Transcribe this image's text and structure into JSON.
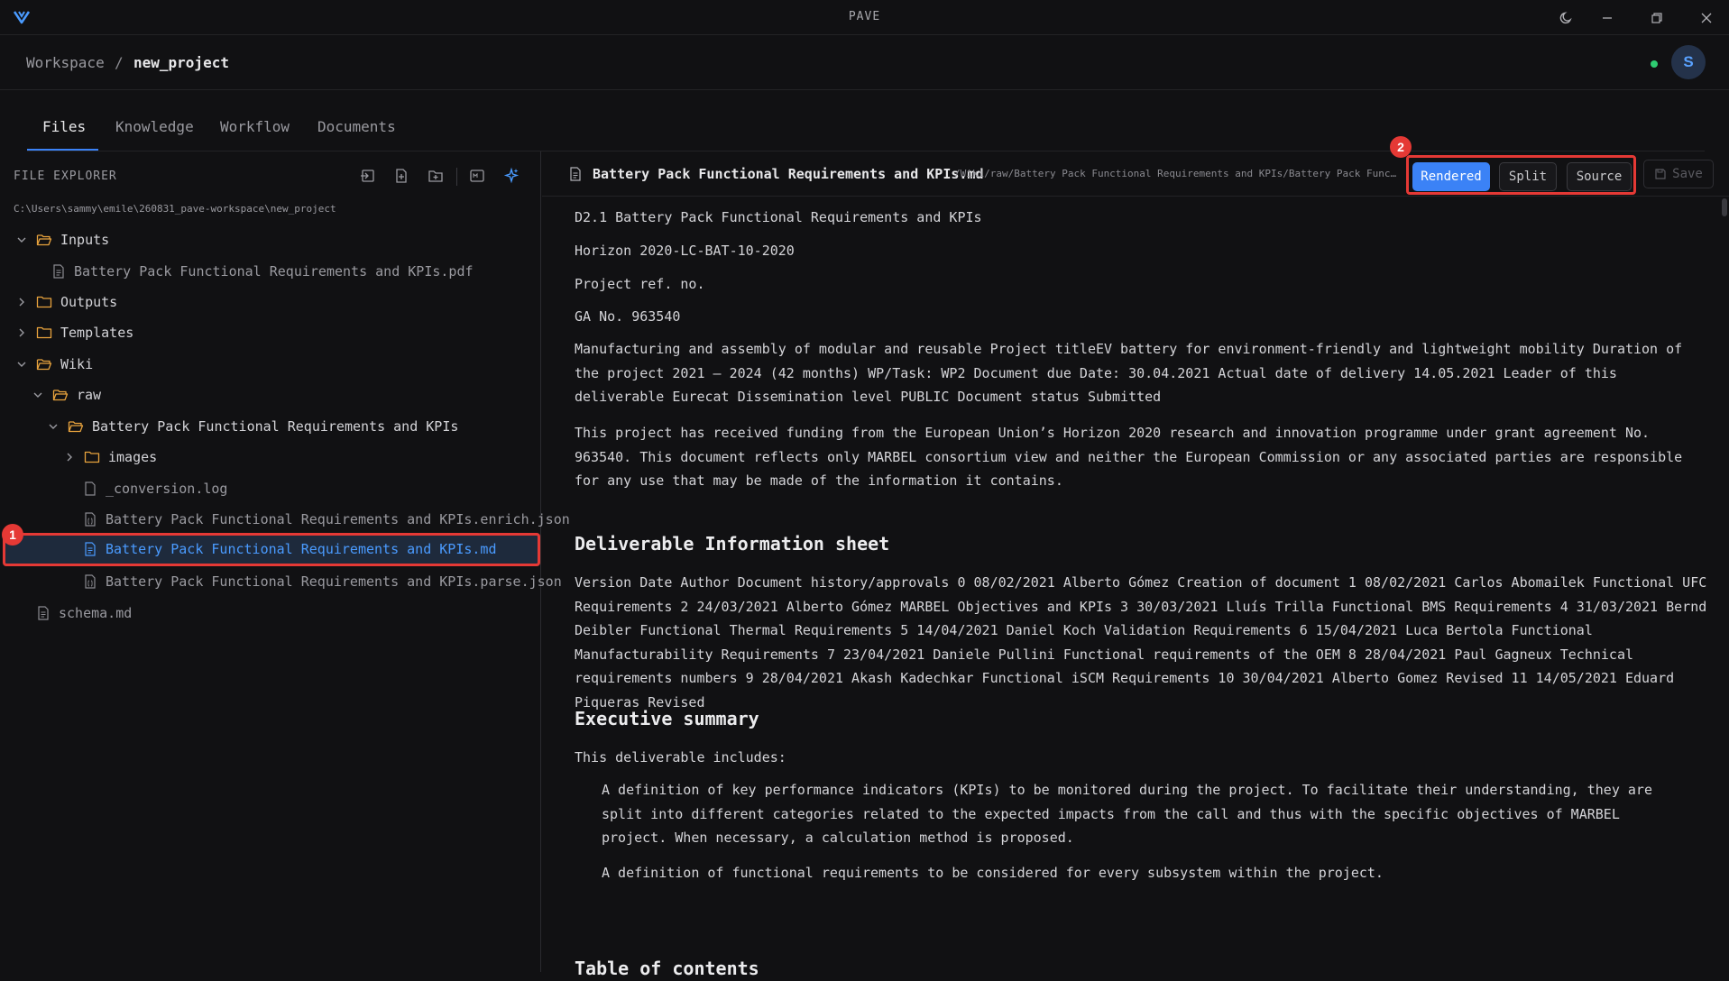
{
  "app": {
    "title": "PAVE"
  },
  "breadcrumb": {
    "workspace": "Workspace",
    "separator": "/",
    "project": "new_project"
  },
  "user": {
    "initial": "S"
  },
  "tabs": [
    {
      "label": "Files"
    },
    {
      "label": "Knowledge"
    },
    {
      "label": "Workflow"
    },
    {
      "label": "Documents"
    }
  ],
  "explorer": {
    "title": "FILE EXPLORER",
    "path": "C:\\Users\\sammy\\emile\\260831_pave-workspace\\new_project",
    "tree": [
      {
        "label": "Inputs"
      },
      {
        "label": "Battery Pack Functional Requirements and KPIs.pdf"
      },
      {
        "label": "Outputs"
      },
      {
        "label": "Templates"
      },
      {
        "label": "Wiki"
      },
      {
        "label": "raw"
      },
      {
        "label": "Battery Pack Functional Requirements and KPIs"
      },
      {
        "label": "images"
      },
      {
        "label": "_conversion.log"
      },
      {
        "label": "Battery Pack Functional Requirements and KPIs.enrich.json"
      },
      {
        "label": "Battery Pack Functional Requirements and KPIs.md"
      },
      {
        "label": "Battery Pack Functional Requirements and KPIs.parse.json"
      },
      {
        "label": "schema.md"
      }
    ]
  },
  "annotations": {
    "badge1": "1",
    "badge2": "2"
  },
  "file": {
    "name": "Battery Pack Functional Requirements and KPIs.md",
    "path": "/Wiki/raw/Battery Pack Functional Requirements and KPIs/Battery Pack Functiona…"
  },
  "view_modes": {
    "rendered": "Rendered",
    "split": "Split",
    "source": "Source",
    "save": "Save"
  },
  "document": {
    "line1": "D2.1 Battery Pack Functional Requirements and KPIs",
    "line2": "Horizon 2020-LC-BAT-10-2020",
    "line3": "Project ref. no.",
    "line4": "GA No. 963540",
    "para1": "Manufacturing and assembly of modular and reusable Project titleEV battery for environment-friendly and lightweight mobility Duration of the project 2021 – 2024 (42 months) WP/Task: WP2 Document due Date: 30.04.2021 Actual date of delivery 14.05.2021 Leader of this deliverable Eurecat Dissemination level PUBLIC Document status Submitted",
    "para2": "This project has received funding from the European Union’s Horizon 2020 research and innovation programme under grant agreement No. 963540. This document reflects only MARBEL consortium view and neither the European Commission or any associated parties are responsible for any use that may be made of the information it contains.",
    "h_info": "Deliverable Information sheet",
    "para3": "Version Date Author Document history/approvals 0 08/02/2021 Alberto Gómez Creation of document 1 08/02/2021 Carlos Abomailek Functional UFC Requirements 2 24/03/2021 Alberto Gómez MARBEL Objectives and KPIs 3 30/03/2021 Lluís Trilla Functional BMS Requirements 4 31/03/2021 Bernd Deibler Functional Thermal Requirements 5 14/04/2021 Daniel Koch Validation Requirements 6 15/04/2021 Luca Bertola Functional Manufacturability Requirements 7 23/04/2021 Daniele Pullini Functional requirements of the OEM 8 28/04/2021 Paul Gagneux Technical requirements numbers 9 28/04/2021 Akash Kadechkar Functional iSCM Requirements 10 30/04/2021 Alberto Gomez Revised 11 14/05/2021 Eduard Piqueras Revised",
    "h_exec": "Executive summary",
    "para4": "This deliverable includes:",
    "bullet1": "A definition of key performance indicators (KPIs) to be monitored during the project. To facilitate their understanding, they are split into different categories related to the expected impacts from the call and thus with the specific objectives of MARBEL project. When necessary, a calculation method is proposed.",
    "bullet2": "A definition of functional requirements to be considered for every subsystem within the project.",
    "h_toc": "Table of contents"
  }
}
